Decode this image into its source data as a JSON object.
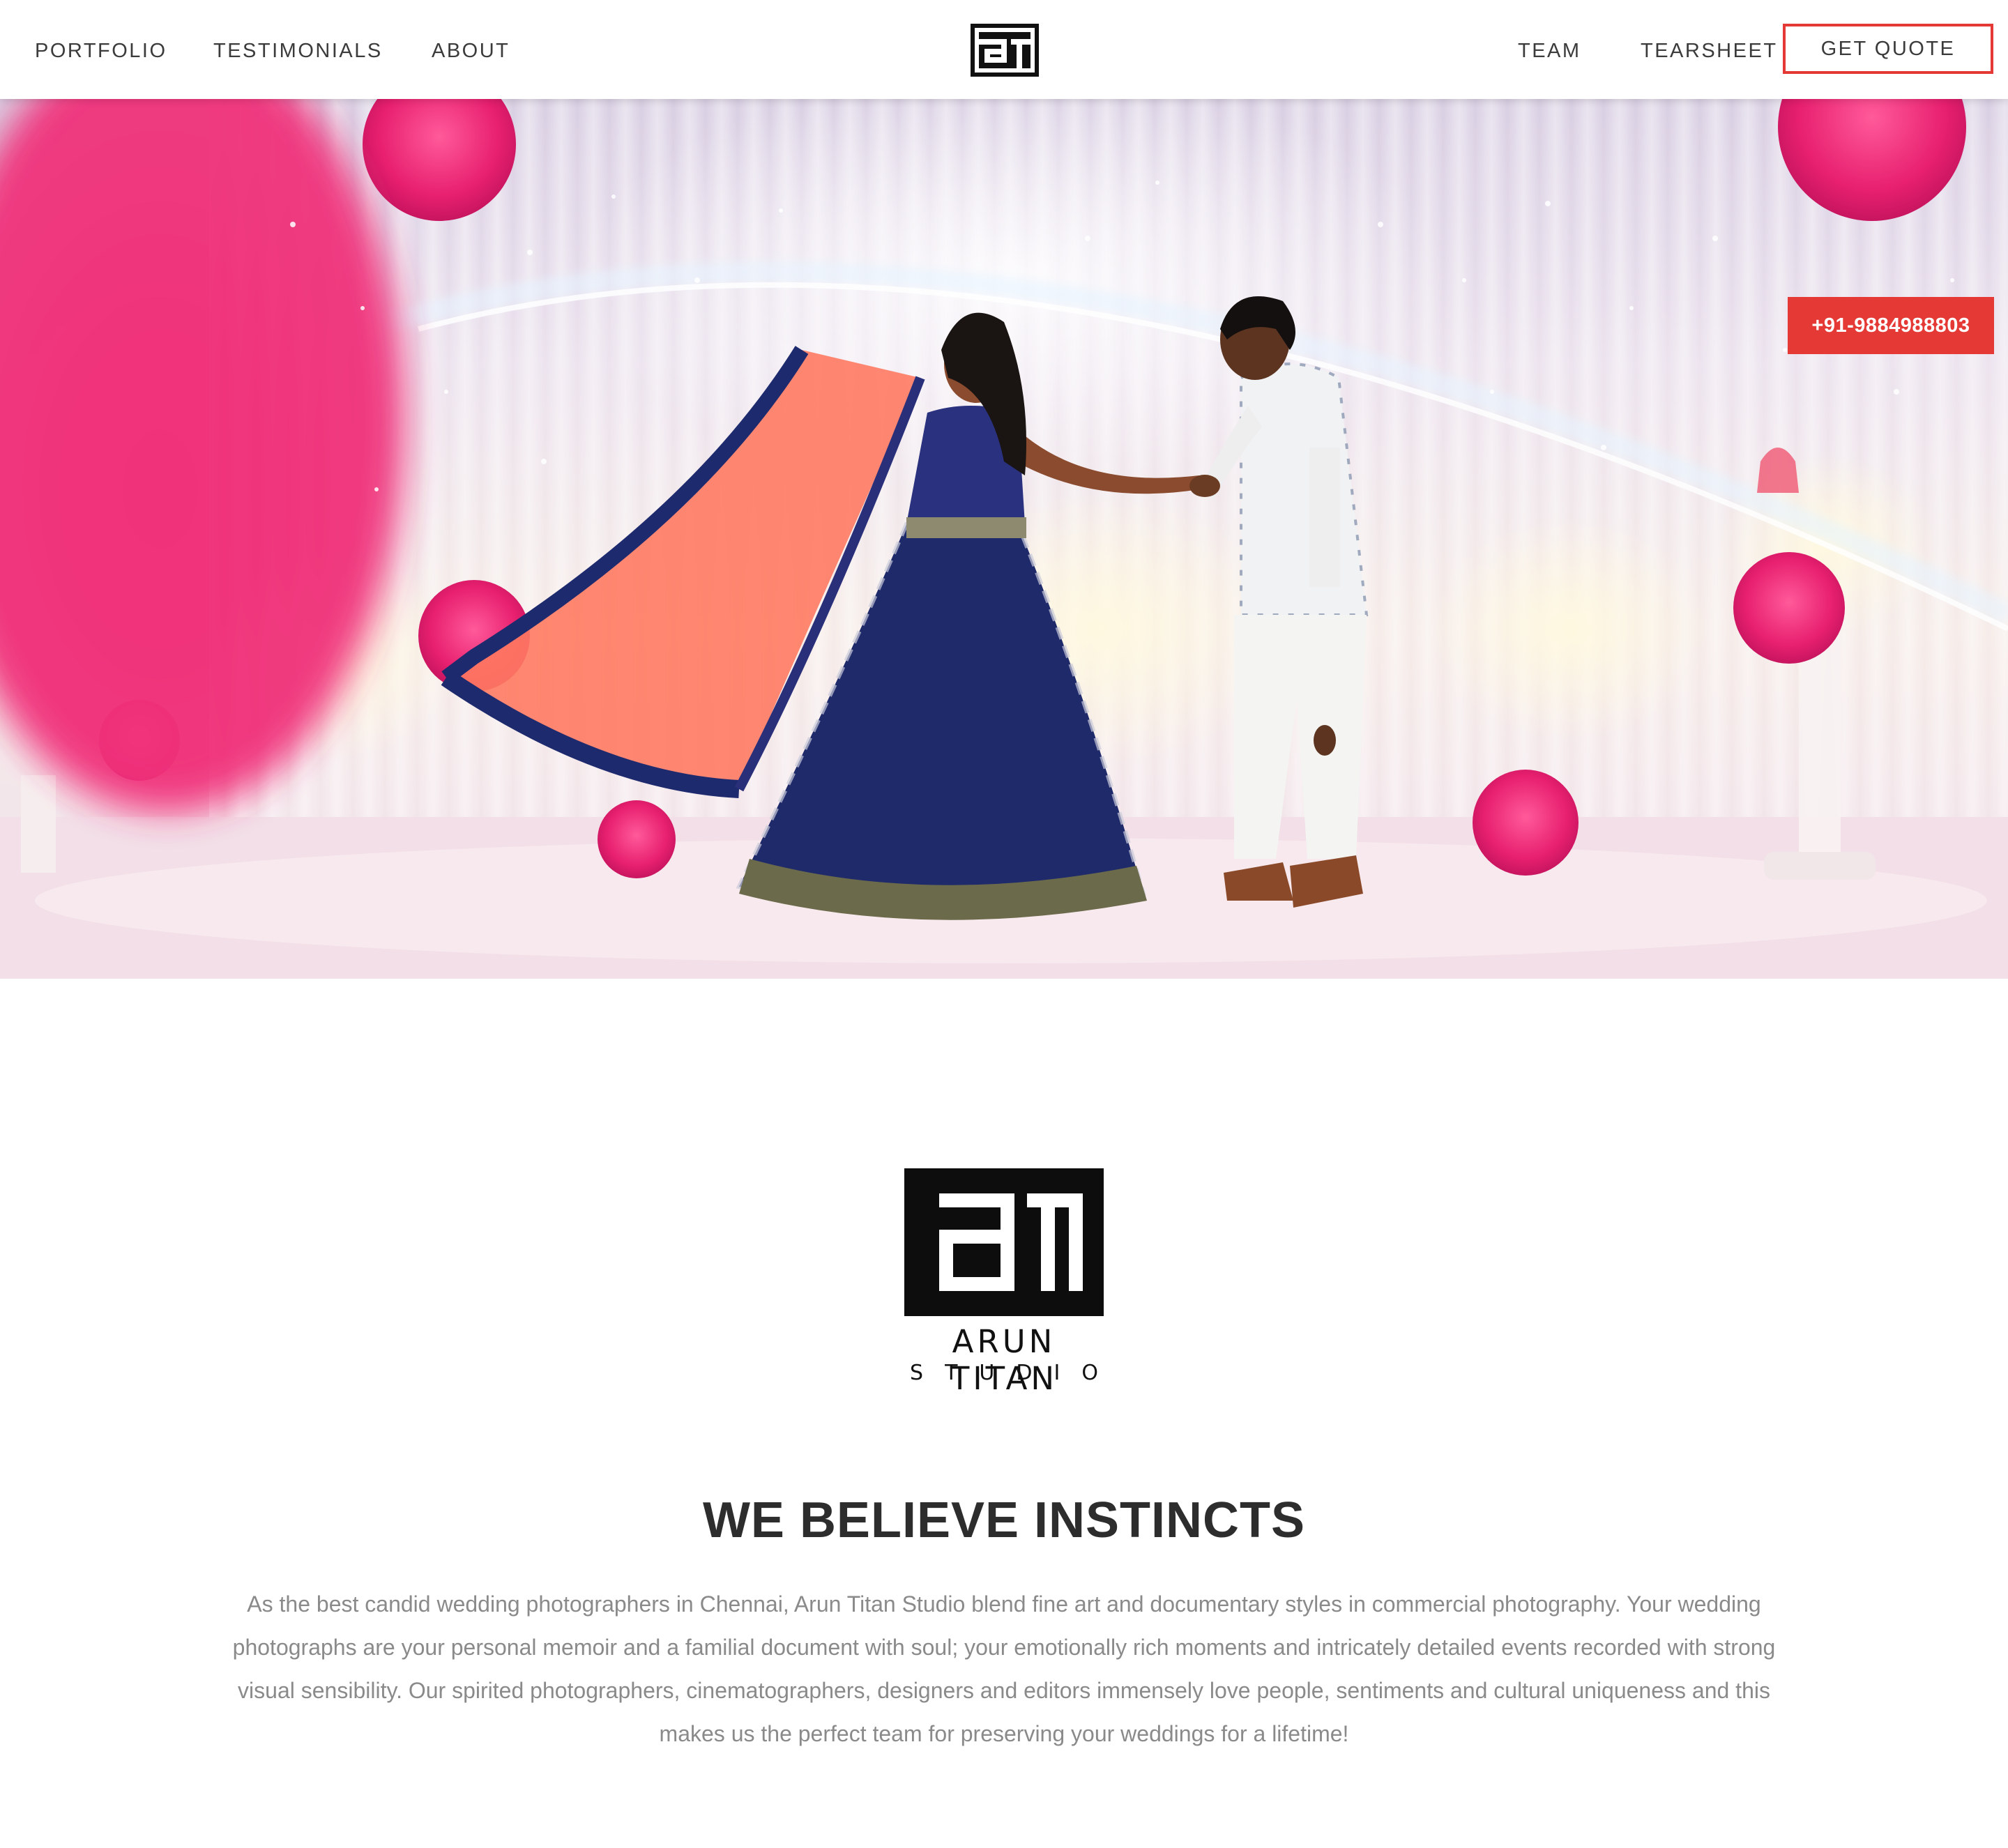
{
  "header": {
    "nav_left": [
      "PORTFOLIO",
      "TESTIMONIALS",
      "ABOUT"
    ],
    "nav_right": [
      "TEAM",
      "TEARSHEET"
    ],
    "cta_label": "GET QUOTE",
    "logo_icon": "at-monogram-logo"
  },
  "hero": {
    "phone_label": "+91-9884988803",
    "image": "bride-and-groom-dancing-on-decorated-stage",
    "accent_color": "#e53935"
  },
  "about": {
    "brand_name": "ARUN TITAN",
    "brand_sub": "STUDIO",
    "title": "WE BELIEVE INSTINCTS",
    "body": "As the best candid wedding photographers in Chennai, Arun Titan Studio blend fine art and documentary styles in commercial photography. Your wedding photographs are your personal memoir and a familial document with soul; your emotionally rich moments and intricately detailed events recorded with strong visual sensibility. Our spirited photographers, cinematographers, designers and editors immensely love people, sentiments and cultural uniqueness and this makes us the perfect team for preserving your weddings for a lifetime!"
  },
  "colors": {
    "accent": "#e53935",
    "text_dark": "#333333",
    "text_muted": "#8a8a8a"
  }
}
